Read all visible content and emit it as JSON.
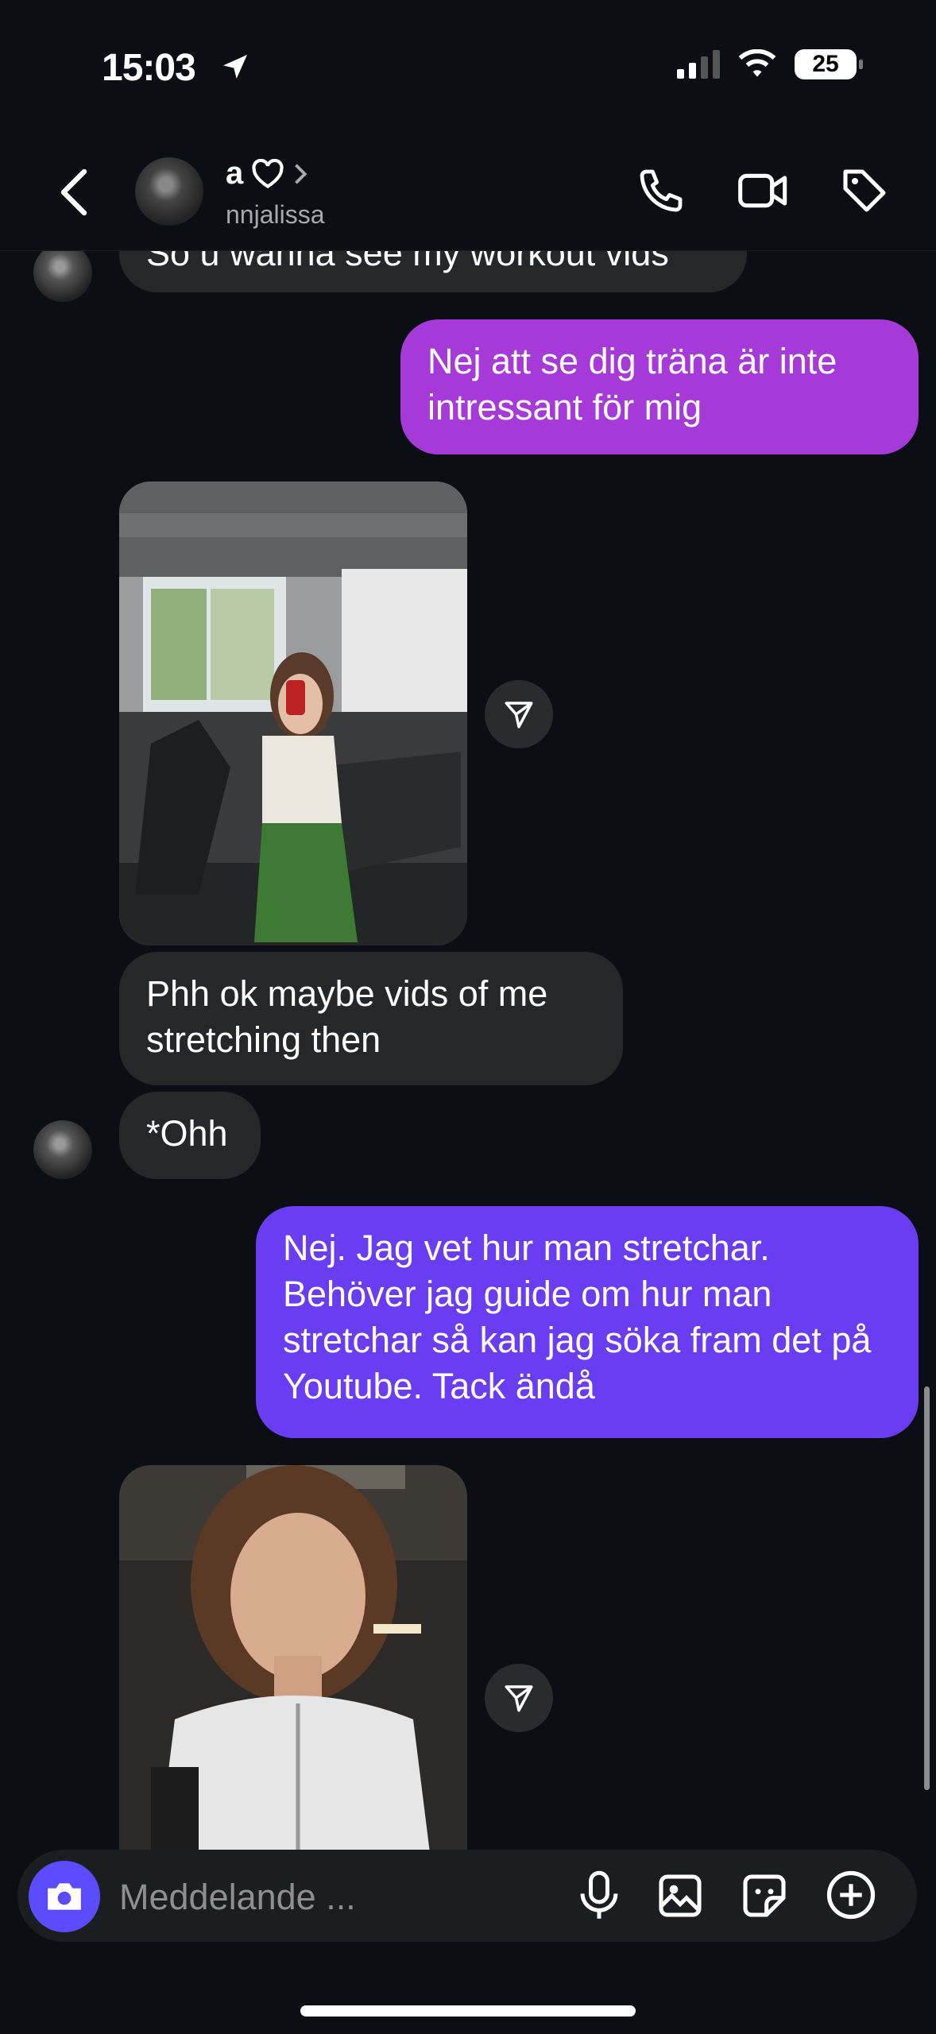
{
  "status": {
    "time": "15:03",
    "battery": "25"
  },
  "header": {
    "name": "a",
    "username": "nnjalissa"
  },
  "messages": {
    "m0": "So u wanna see my workout vids",
    "m1": "Nej att se dig träna är inte intressant för mig",
    "m2": "Phh ok maybe vids of me stretching then",
    "m3": "*Ohh",
    "m4": "Nej. Jag vet hur man stretchar. Behöver jag guide om hur man stretchar så kan jag söka fram det på Youtube. Tack ändå"
  },
  "composer": {
    "placeholder": "Meddelande ..."
  },
  "colors": {
    "outgoing_1": "#a53ad8",
    "outgoing_2": "#6a3df2",
    "incoming": "#262729",
    "camera_button": "#5b4dff"
  },
  "icons": [
    "location-arrow-icon",
    "signal-icon",
    "wifi-icon",
    "battery-icon",
    "back-chevron-icon",
    "heart-icon",
    "chevron-right-icon",
    "phone-icon",
    "video-icon",
    "tag-icon",
    "share-icon",
    "camera-icon",
    "microphone-icon",
    "gallery-icon",
    "sticker-icon",
    "plus-icon"
  ]
}
